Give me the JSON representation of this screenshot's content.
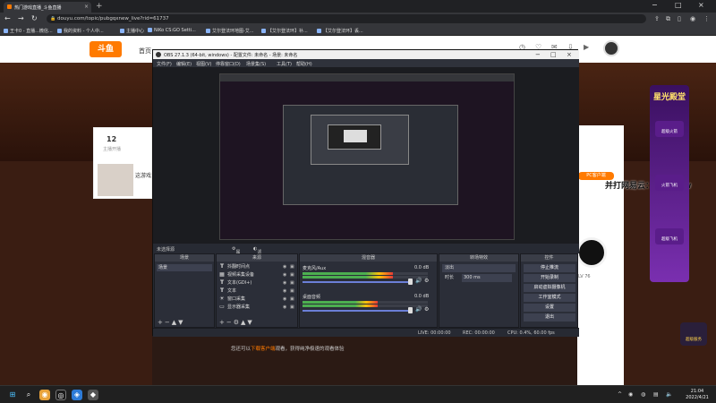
{
  "browser": {
    "tab_title": "热门游戏直播_斗鱼直播",
    "url": "douyu.com/topic/pubgqxnew_live?rid=61737",
    "bookmarks": [
      "王卡0 - 直播...微信...",
      "我的资料 - 个人中...",
      "主播中心",
      "NiKo CS:GO Setti...",
      "艾尔登法环地图-艾...",
      "【艾尔登法环】补...",
      "【艾尔登法环】丢..."
    ]
  },
  "site": {
    "logo": "斗鱼",
    "nav_first": "首页",
    "follow_count": "12",
    "follow_label": "主播开播",
    "streamer_note": "这游戏",
    "live_button": "PC客户端",
    "bottom_prefix": "您还可以",
    "bottom_link": "下载客户端",
    "bottom_suffix": "观看，获得纯净极速的观看体验",
    "overlay_text": "并打网易云：karlwow",
    "right_text": "LV 76",
    "ad_title": "星光殿堂",
    "ad_items": [
      "超级火箭",
      "火箭飞机",
      "超级飞机"
    ],
    "side_badge": "超级服务"
  },
  "obs": {
    "title": "OBS 27.1.3 (64-bit, windows) - 配置文件: 未命名 - 场景: 未命名",
    "menu": [
      "文件(F)",
      "编辑(E)",
      "视图(V)",
      "停靠窗口(D)",
      "场景集(S)",
      "工具(T)",
      "帮助(H)"
    ],
    "scene_bar": "未选择源",
    "properties_btn": "属性",
    "filters_btn": "滤镜",
    "docks": {
      "scenes": "场景",
      "sources": "来源",
      "mixer": "混音器",
      "transitions": "转场特效",
      "controls": "控件"
    },
    "scene_item": "场景",
    "sources": [
      {
        "icon": "T",
        "label": "抖翻时间点"
      },
      {
        "icon": "▦",
        "label": "视频采集设备"
      },
      {
        "icon": "T",
        "label": "文本(GDI+)"
      },
      {
        "icon": "T",
        "label": "文本"
      },
      {
        "icon": "☀",
        "label": "窗口采集"
      },
      {
        "icon": "▭",
        "label": "显示器采集"
      }
    ],
    "mixer": [
      {
        "name": "麦克风/Aux",
        "db": "0.0 dB",
        "level": 0.72
      },
      {
        "name": "桌面音频",
        "db": "0.0 dB",
        "level": 0.6
      }
    ],
    "transition": "淡出",
    "duration_label": "时长",
    "duration_value": "300 ms",
    "controls": [
      "停止推流",
      "开始录制",
      "启动虚拟摄像机",
      "工作室模式",
      "设置",
      "退出"
    ],
    "status": {
      "live": "LIVE: 00:00:00",
      "rec": "REC: 00:00:00",
      "cpu": "CPU: 0.4%, 60.00 fps"
    }
  },
  "taskbar": {
    "time": "21:04",
    "date": "2022/4/21"
  }
}
